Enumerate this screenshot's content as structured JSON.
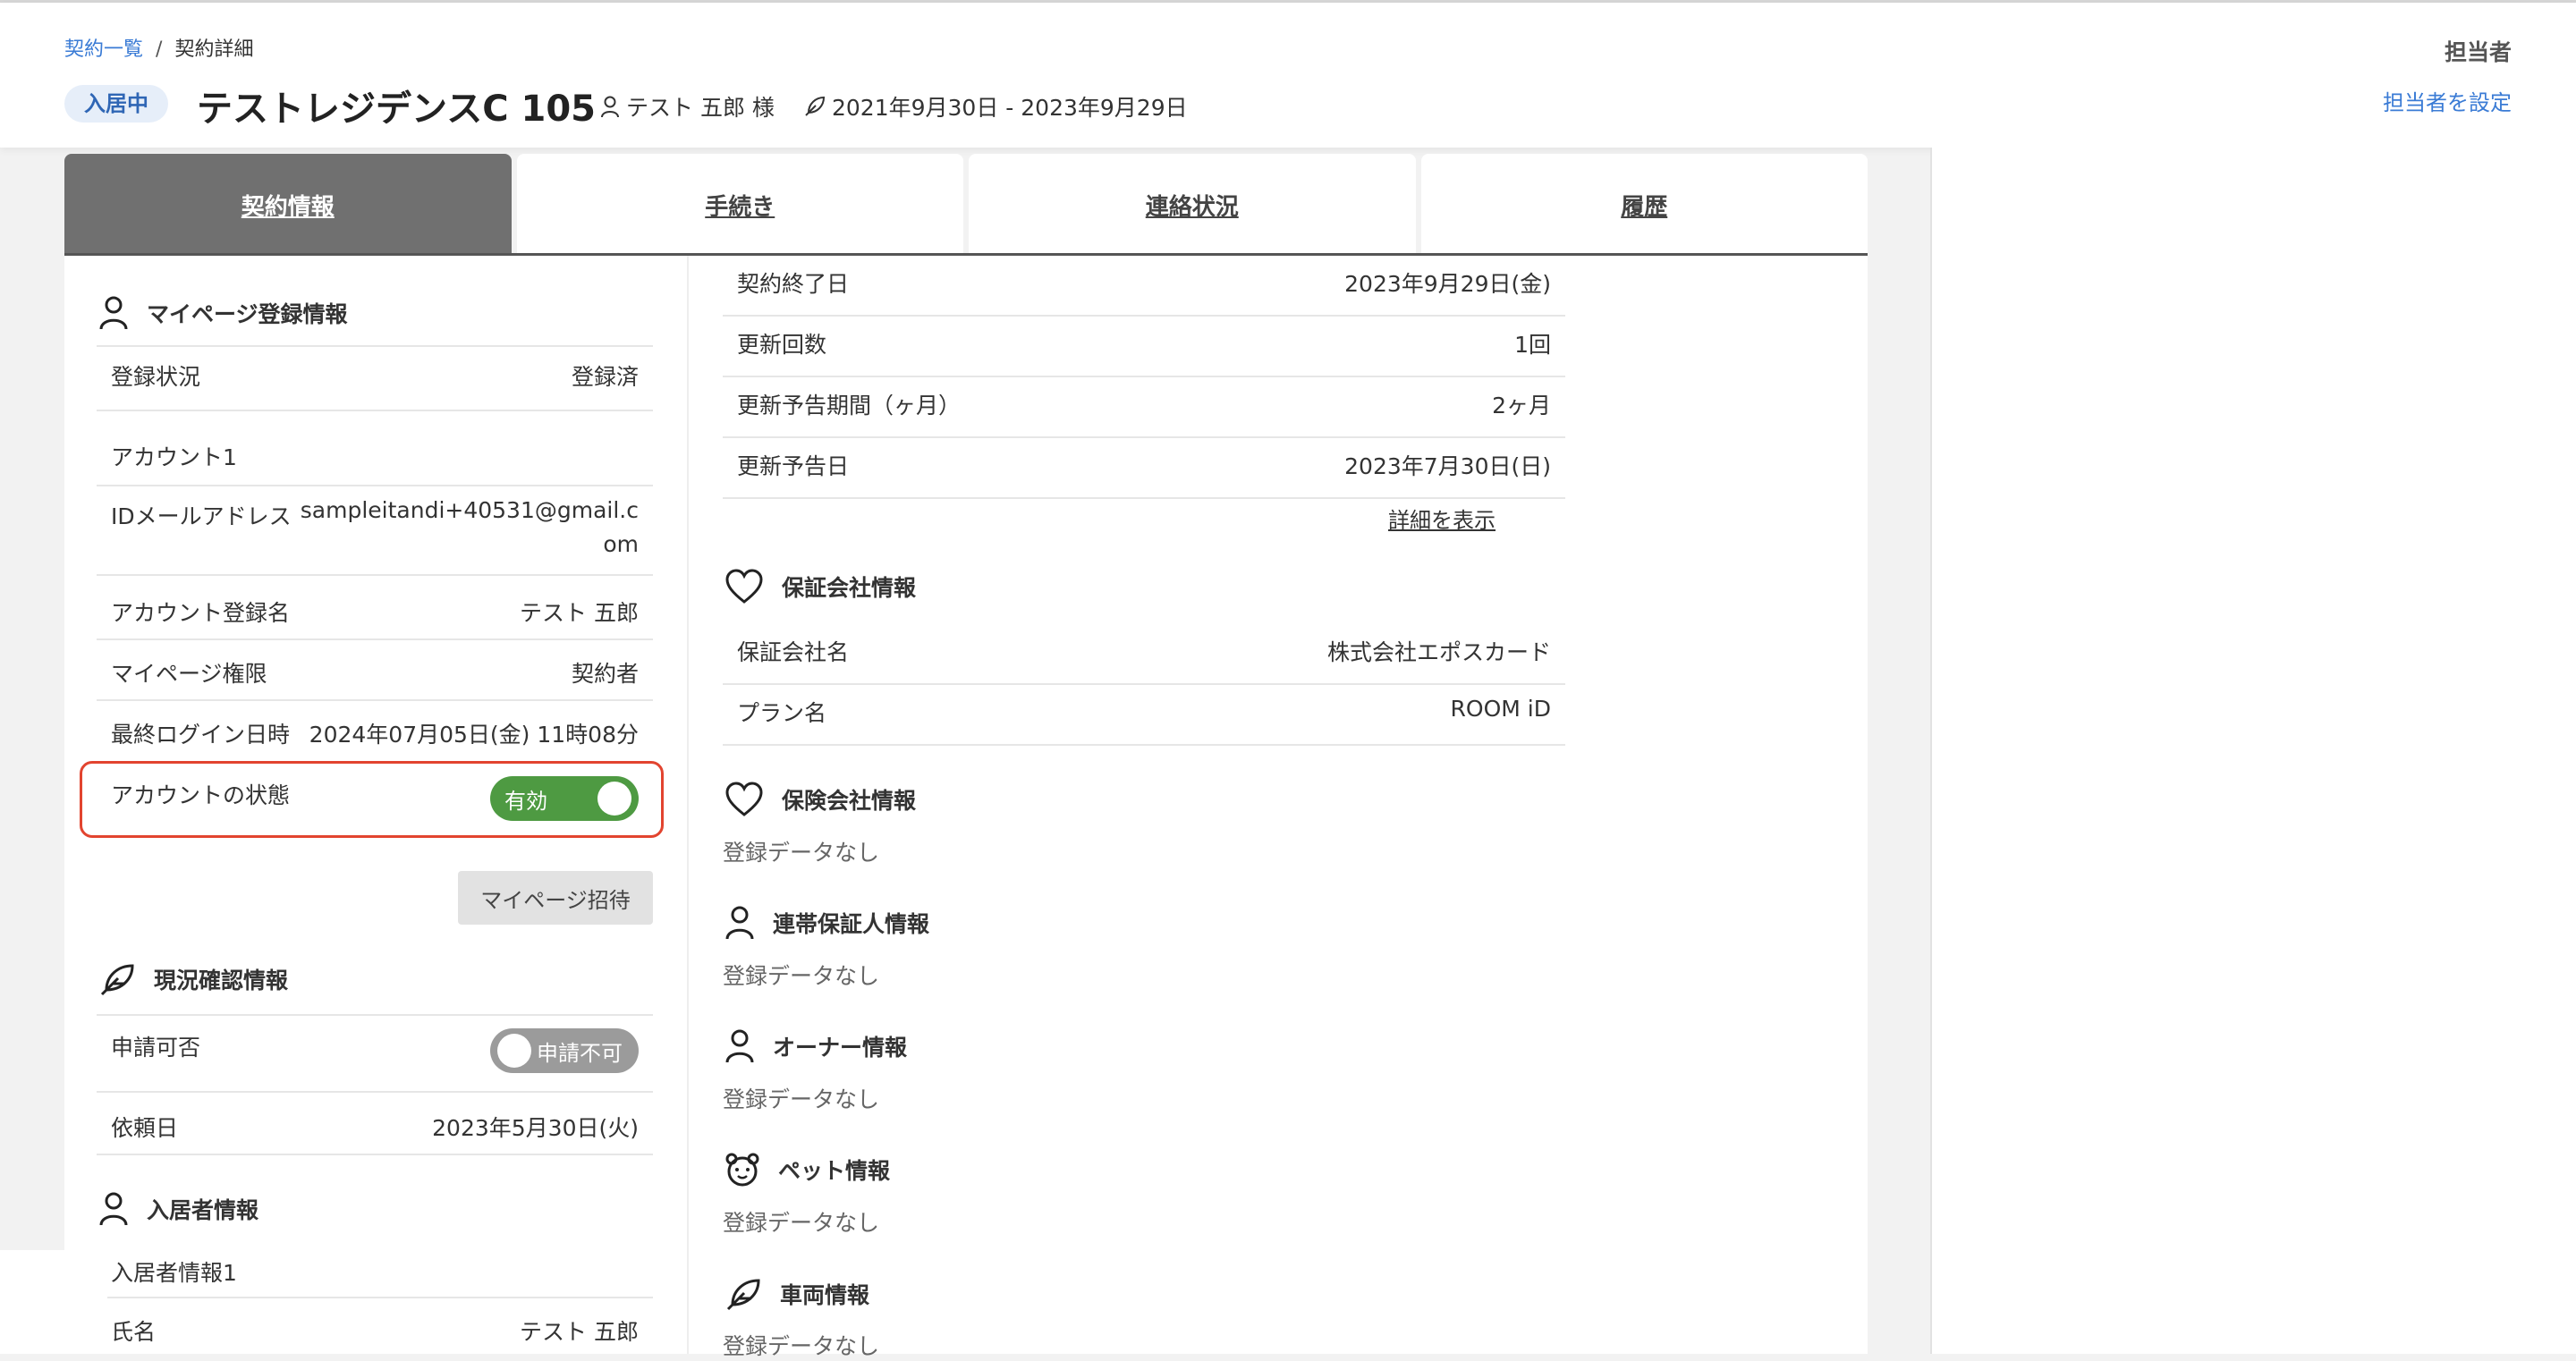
{
  "breadcrumb": {
    "parent": "契約一覧",
    "current": "契約詳細"
  },
  "header": {
    "status": "入居中",
    "title": "テストレジデンスC 105",
    "tenant": "テスト 五郎 様",
    "period": "2021年9月30日 - 2023年9月29日",
    "assignee_label": "担当者",
    "assignee_link": "担当者を設定"
  },
  "tabs": [
    "契約情報",
    "手続き",
    "連絡状況",
    "履歴"
  ],
  "mypage": {
    "title": "マイページ登録情報",
    "reg_status_label": "登録状況",
    "reg_status_value": "登録済",
    "account_heading": "アカウント1",
    "email_label": "IDメールアドレス",
    "email_value_line1": "sampleitandi+40531@gmail.c",
    "email_value_line2": "om",
    "account_name_label": "アカウント登録名",
    "account_name_value": "テスト 五郎",
    "permission_label": "マイページ権限",
    "permission_value": "契約者",
    "last_login_label": "最終ログイン日時",
    "last_login_value": "2024年07月05日(金) 11時08分",
    "account_state_label": "アカウントの状態",
    "account_state_toggle": "有効",
    "invite_button": "マイページ招待"
  },
  "status_check": {
    "title": "現況確認情報",
    "apply_label": "申請可否",
    "apply_toggle": "申請不可",
    "request_date_label": "依頼日",
    "request_date_value": "2023年5月30日(火)"
  },
  "resident": {
    "title": "入居者情報",
    "sub_heading": "入居者情報1",
    "name_label": "氏名",
    "name_value": "テスト 五郎"
  },
  "contract": {
    "end_date_label": "契約終了日",
    "end_date_value": "2023年9月29日(金)",
    "renewal_count_label": "更新回数",
    "renewal_count_value": "1回",
    "notice_period_label": "更新予告期間（ヶ月）",
    "notice_period_value": "2ヶ月",
    "notice_date_label": "更新予告日",
    "notice_date_value": "2023年7月30日(日)",
    "detail_link": "詳細を表示"
  },
  "guarantor_company": {
    "title": "保証会社情報",
    "name_label": "保証会社名",
    "name_value": "株式会社エポスカード",
    "plan_label": "プラン名",
    "plan_value": "ROOM iD"
  },
  "insurance": {
    "title": "保険会社情報",
    "empty": "登録データなし"
  },
  "joint_guarantor": {
    "title": "連帯保証人情報",
    "empty": "登録データなし"
  },
  "owner": {
    "title": "オーナー情報",
    "empty": "登録データなし"
  },
  "pet": {
    "title": "ペット情報",
    "empty": "登録データなし"
  },
  "vehicle": {
    "title": "車両情報",
    "empty": "登録データなし"
  },
  "colors": {
    "accent": "#3a7bd5",
    "toggle_on": "#4e9a42",
    "toggle_off": "#9b9b9b",
    "highlight": "#e2442f",
    "active_tab": "#707070"
  }
}
